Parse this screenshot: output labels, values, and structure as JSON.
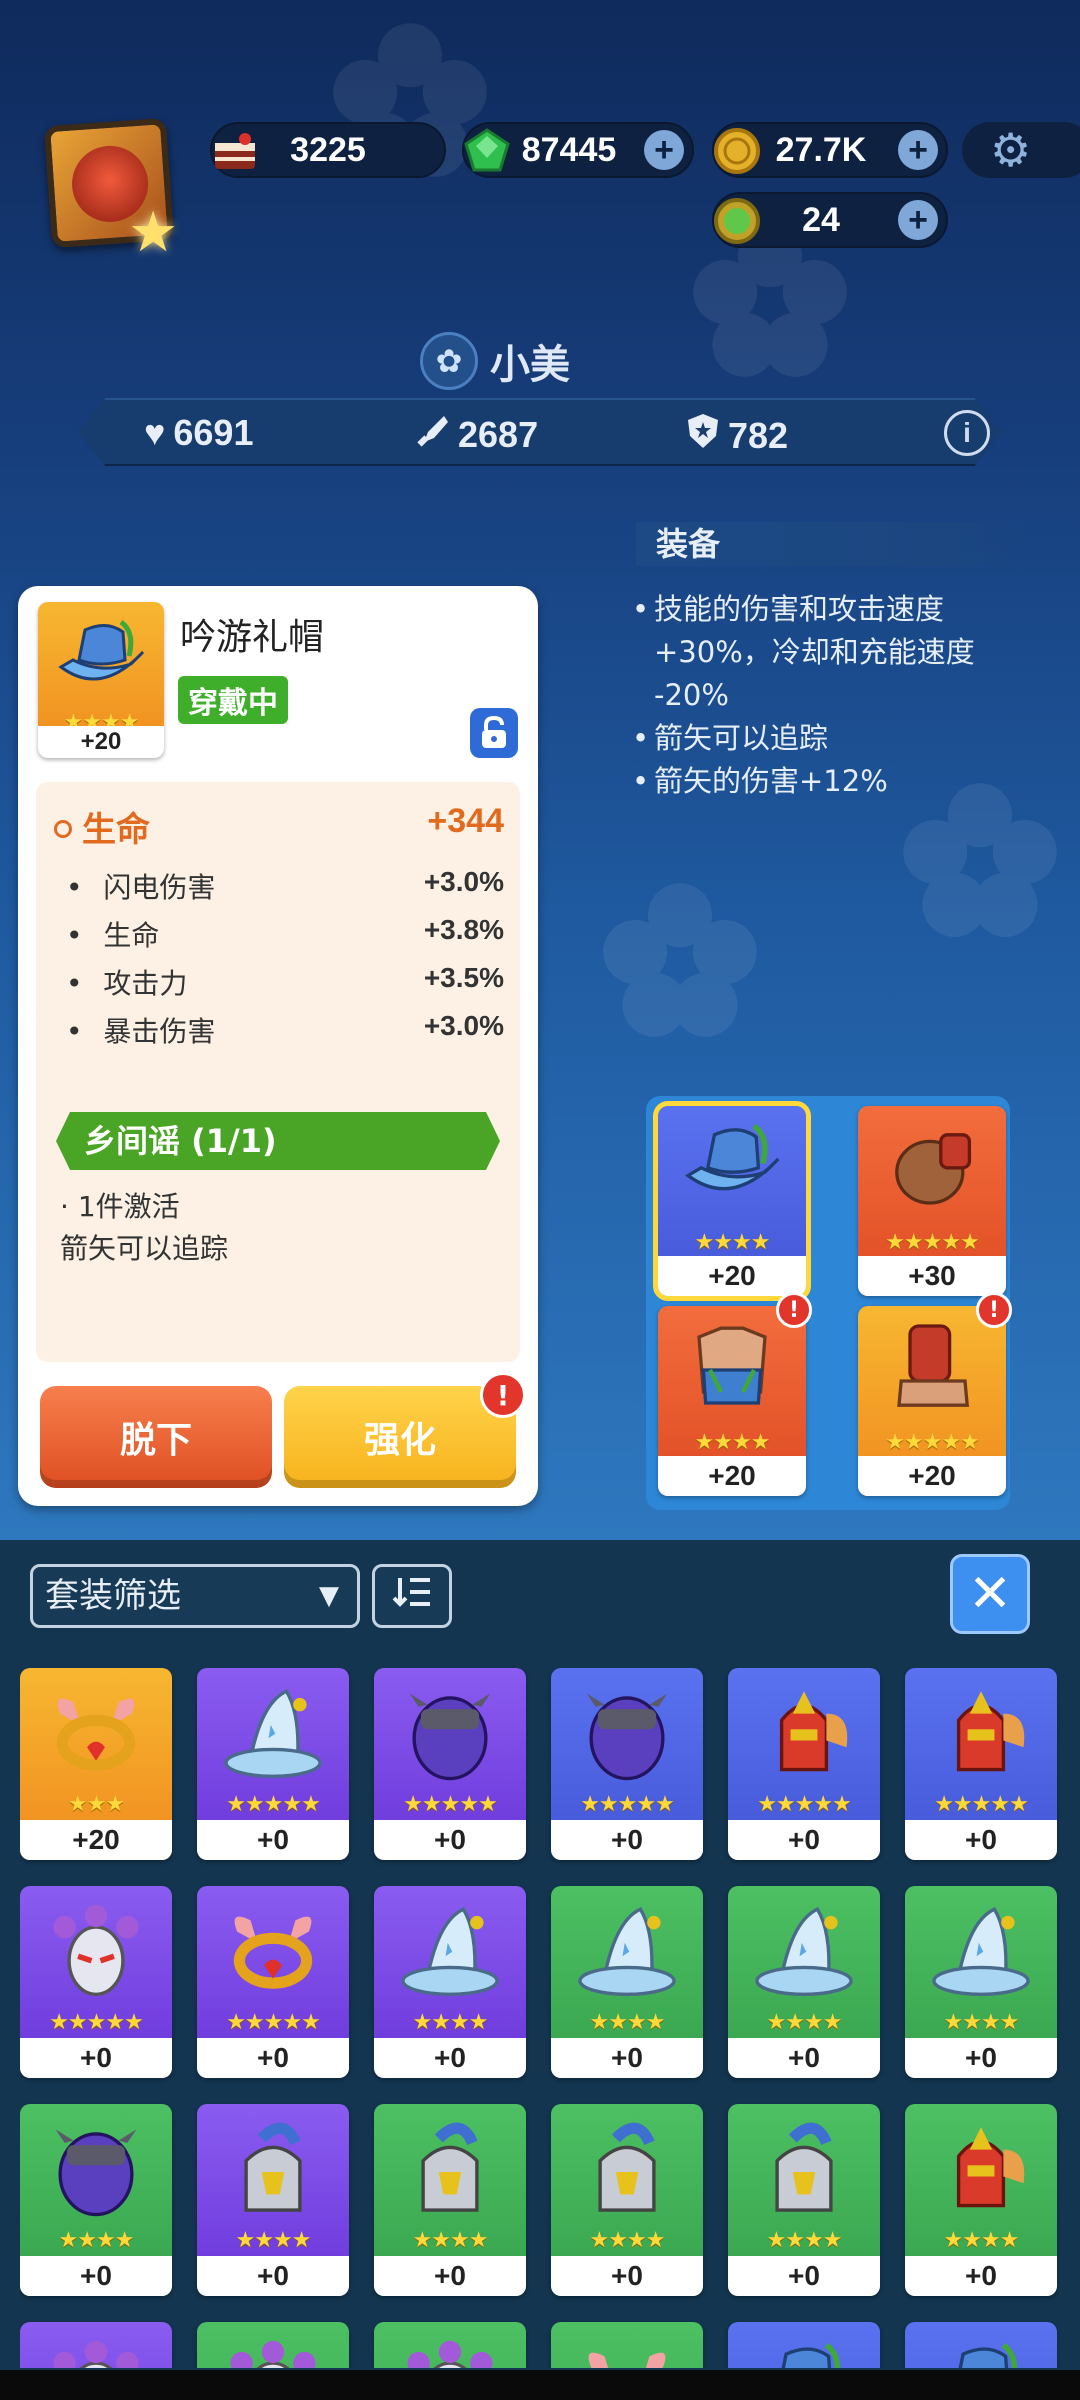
{
  "resources": [
    {
      "icon": "cake-icon",
      "value": "3225",
      "has_plus": false
    },
    {
      "icon": "gem-icon",
      "value": "87445",
      "has_plus": true
    },
    {
      "icon": "coin-icon",
      "value": "27.7K",
      "has_plus": true
    },
    {
      "icon": "token-icon",
      "value": "24",
      "has_plus": true
    }
  ],
  "hero": {
    "name": "小美"
  },
  "stats": {
    "health": "6691",
    "attack": "2687",
    "defense": "782"
  },
  "set_panel": {
    "title": "装备",
    "lines": [
      "技能的伤害和攻击速度",
      "+30%，冷却和充能速度",
      "-20%",
      "箭矢可以追踪",
      "箭矢的伤害+12%"
    ]
  },
  "item": {
    "name": "吟游礼帽",
    "status": "穿戴中",
    "level": "+20",
    "stars": "★★★★",
    "main_stat": {
      "label": "生命",
      "value": "+344"
    },
    "sub_stats": [
      {
        "label": "闪电伤害",
        "value": "+3.0%"
      },
      {
        "label": "生命",
        "value": "+3.8%"
      },
      {
        "label": "攻击力",
        "value": "+3.5%"
      },
      {
        "label": "暴击伤害",
        "value": "+3.0%"
      }
    ],
    "set_name": "乡间谣 (1/1)",
    "set_activation": "1件激活",
    "set_effect": "箭矢可以追踪",
    "unequip_label": "脱下",
    "upgrade_label": "强化"
  },
  "equipped": [
    {
      "slot": "hat",
      "bg": "blue",
      "art": "hat-icon",
      "level": "+20",
      "stars": "★★★★",
      "alert": false,
      "selected": true
    },
    {
      "slot": "gloves",
      "bg": "red",
      "art": "glove-icon",
      "level": "+30",
      "stars": "★★★★★",
      "alert": false,
      "selected": false
    },
    {
      "slot": "armor",
      "bg": "red",
      "art": "armor-icon",
      "level": "+20",
      "stars": "★★★★",
      "alert": true,
      "selected": false
    },
    {
      "slot": "boots",
      "bg": "orange",
      "art": "boot-icon",
      "level": "+20",
      "stars": "★★★★★",
      "alert": true,
      "selected": false
    }
  ],
  "filter": {
    "label": "套装筛选"
  },
  "inventory": [
    {
      "bg": "orange",
      "art": "ring-icon",
      "level": "+20",
      "stars": "★★★"
    },
    {
      "bg": "purple",
      "art": "wizard-hat-icon",
      "level": "+0",
      "stars": "★★★★★"
    },
    {
      "bg": "purple",
      "art": "helmet-icon",
      "level": "+0",
      "stars": "★★★★★"
    },
    {
      "bg": "blue",
      "art": "helmet-icon",
      "level": "+0",
      "stars": "★★★★★"
    },
    {
      "bg": "blue",
      "art": "phoenix-helm-icon",
      "level": "+0",
      "stars": "★★★★★"
    },
    {
      "bg": "blue",
      "art": "phoenix-helm-icon",
      "level": "+0",
      "stars": "★★★★★"
    },
    {
      "bg": "purple",
      "art": "medusa-mask-icon",
      "level": "+0",
      "stars": "★★★★★"
    },
    {
      "bg": "purple",
      "art": "ring-icon",
      "level": "+0",
      "stars": "★★★★★"
    },
    {
      "bg": "purple",
      "art": "wizard-hat-icon",
      "level": "+0",
      "stars": "★★★★"
    },
    {
      "bg": "green",
      "art": "wizard-hat-icon",
      "level": "+0",
      "stars": "★★★★"
    },
    {
      "bg": "green",
      "art": "wizard-hat-icon",
      "level": "+0",
      "stars": "★★★★"
    },
    {
      "bg": "green",
      "art": "wizard-hat-icon",
      "level": "+0",
      "stars": "★★★★"
    },
    {
      "bg": "green",
      "art": "helmet-icon",
      "level": "+0",
      "stars": "★★★★"
    },
    {
      "bg": "purple",
      "art": "knight-helm-icon",
      "level": "+0",
      "stars": "★★★★"
    },
    {
      "bg": "green",
      "art": "knight-helm-icon",
      "level": "+0",
      "stars": "★★★★"
    },
    {
      "bg": "green",
      "art": "knight-helm-icon",
      "level": "+0",
      "stars": "★★★★"
    },
    {
      "bg": "green",
      "art": "knight-helm-icon",
      "level": "+0",
      "stars": "★★★★"
    },
    {
      "bg": "green",
      "art": "phoenix-helm-icon",
      "level": "+0",
      "stars": "★★★★"
    },
    {
      "bg": "purple",
      "art": "medusa-mask-icon",
      "level": "",
      "stars": ""
    },
    {
      "bg": "green",
      "art": "medusa-mask-icon",
      "level": "",
      "stars": ""
    },
    {
      "bg": "green",
      "art": "medusa-mask-icon",
      "level": "",
      "stars": ""
    },
    {
      "bg": "green",
      "art": "ring-icon",
      "level": "",
      "stars": ""
    },
    {
      "bg": "blue",
      "art": "hat-icon",
      "level": "",
      "stars": ""
    },
    {
      "bg": "blue",
      "art": "hat-icon",
      "level": "",
      "stars": ""
    }
  ]
}
